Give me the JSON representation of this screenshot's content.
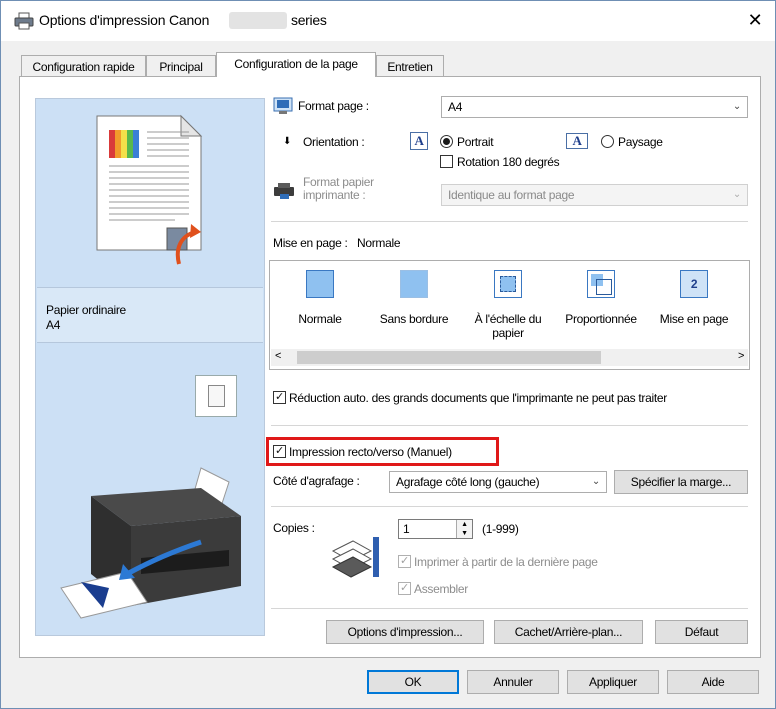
{
  "window": {
    "title_prefix": "Options d'impression Canon",
    "title_suffix": "series",
    "close_glyph": "✕",
    "icon": "printer-icon"
  },
  "tabs": [
    {
      "label": "Configuration rapide"
    },
    {
      "label": "Principal"
    },
    {
      "label": "Configuration de la page",
      "active": true
    },
    {
      "label": "Entretien"
    }
  ],
  "preview": {
    "paper_type": "Papier ordinaire",
    "paper_size": "A4"
  },
  "page_setup": {
    "page_size_label": "Format page :",
    "page_size_value": "A4",
    "orientation_label": "Orientation :",
    "portrait_label": "Portrait",
    "landscape_label": "Paysage",
    "orientation_selected": "Portrait",
    "rotate_label": "Rotation 180 degrés",
    "rotate_checked": false,
    "printer_paper_label_1": "Format papier",
    "printer_paper_label_2": "imprimante :",
    "printer_paper_value": "Identique au format page",
    "printer_paper_enabled": false
  },
  "layout": {
    "label": "Mise en page :",
    "current": "Normale",
    "options": [
      {
        "label": "Normale"
      },
      {
        "label": "Sans bordure"
      },
      {
        "label_1": "À l'échelle du",
        "label_2": "papier"
      },
      {
        "label": "Proportionnée"
      },
      {
        "label": "Mise en page",
        "icon_number": "2"
      }
    ],
    "scroll_left": "<",
    "scroll_right": ">"
  },
  "auto_reduce": {
    "label": "Réduction auto. des grands documents que l'imprimante ne peut pas traiter",
    "checked": true
  },
  "duplex": {
    "label": "Impression recto/verso (Manuel)",
    "checked": true,
    "stapling_label": "Côté d'agrafage :",
    "stapling_value": "Agrafage côté long (gauche)",
    "margin_button": "Spécifier la marge..."
  },
  "copies": {
    "label": "Copies :",
    "value": "1",
    "range": "(1-999)",
    "print_from_last_label": "Imprimer à partir de la dernière page",
    "collate_label": "Assembler"
  },
  "bottom_buttons": {
    "print_options": "Options d'impression...",
    "stamp_background": "Cachet/Arrière-plan...",
    "defaults": "Défaut"
  },
  "dialog_buttons": {
    "ok": "OK",
    "cancel": "Annuler",
    "apply": "Appliquer",
    "help": "Aide"
  },
  "colors": {
    "preview_bg": "#cce0f5",
    "highlight": "#e01818",
    "accent": "#0078d7"
  }
}
